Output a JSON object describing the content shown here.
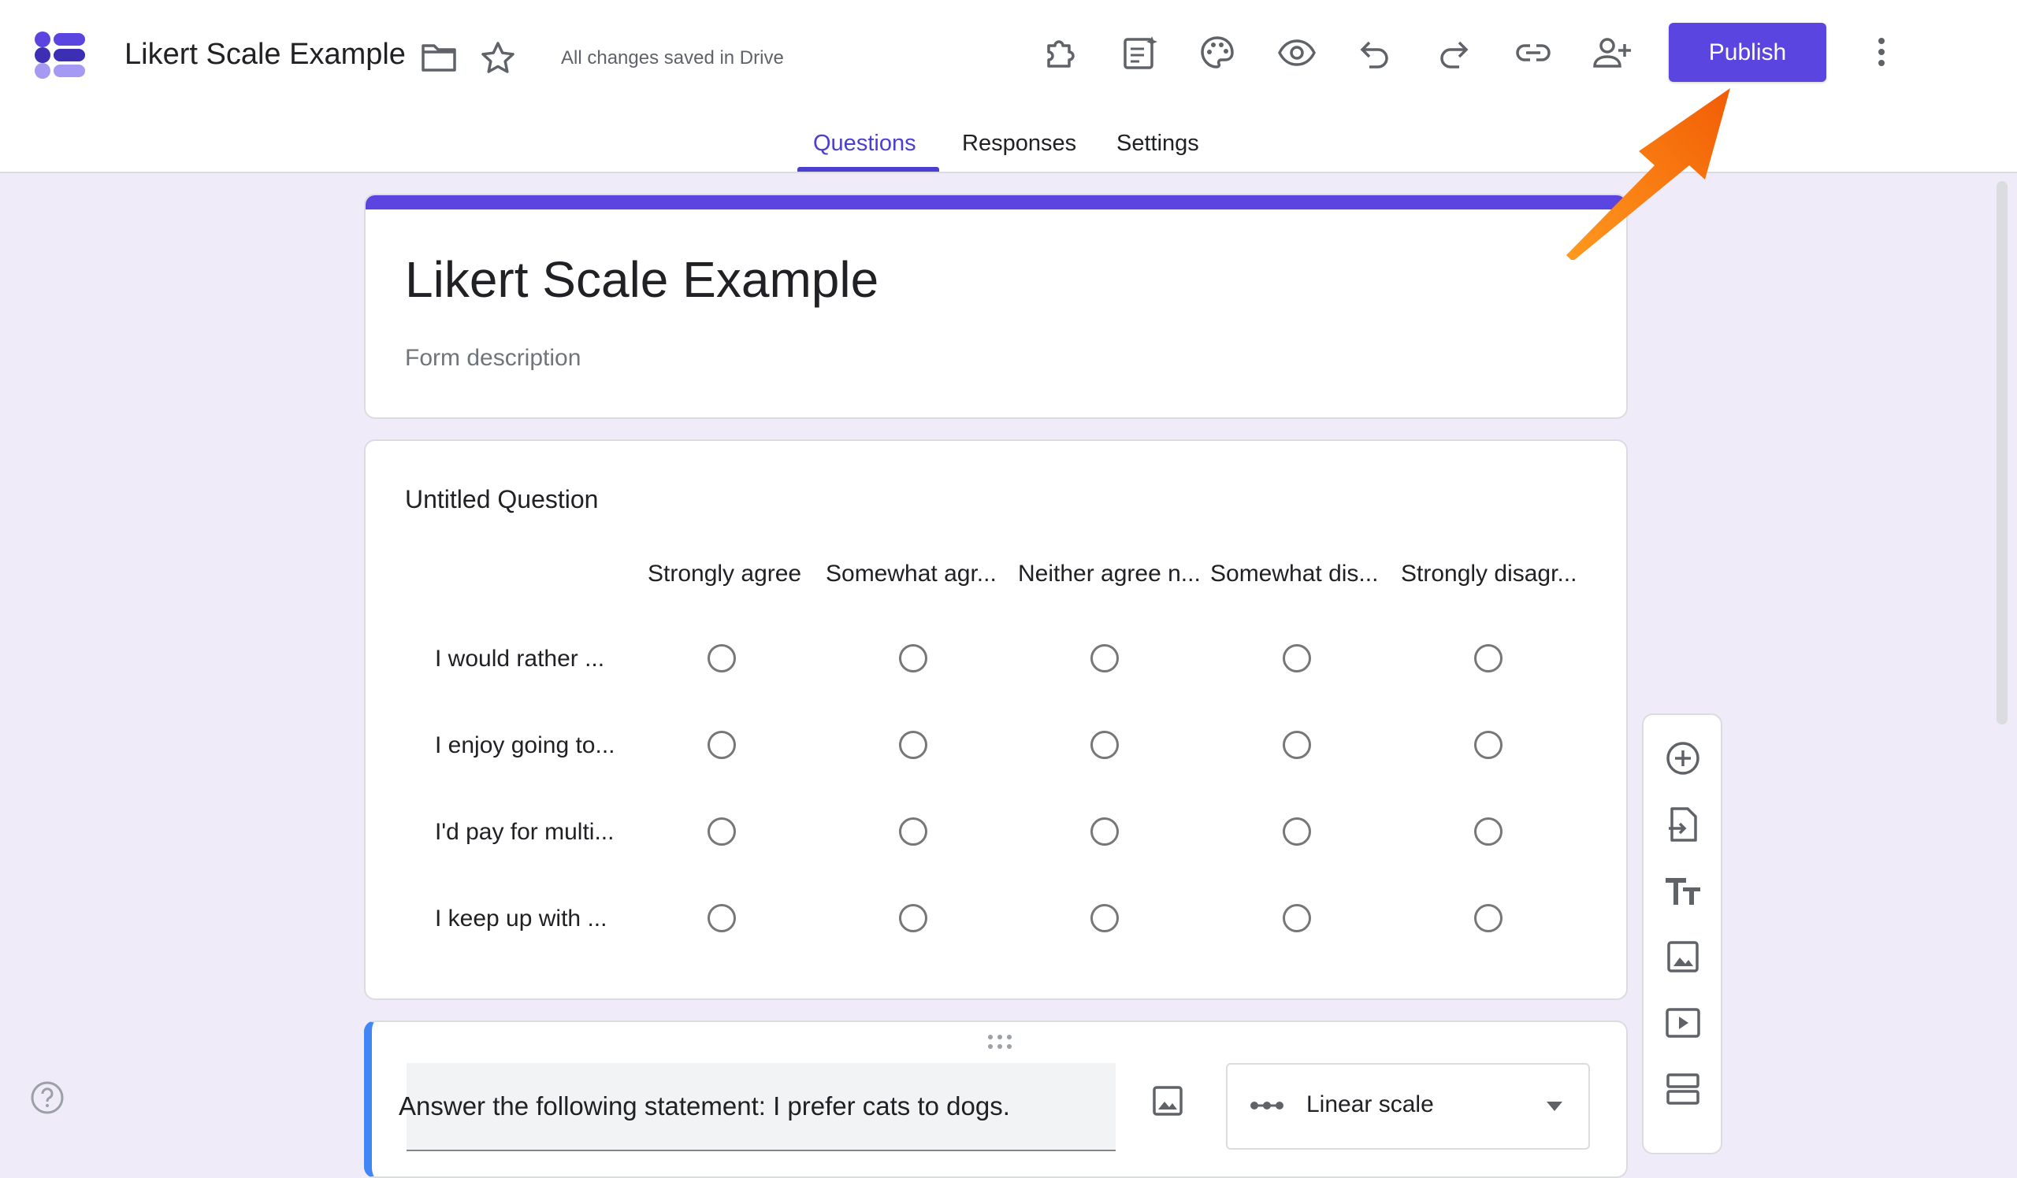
{
  "header": {
    "doc_title": "Likert Scale Example",
    "save_status": "All changes saved in Drive",
    "publish_label": "Publish",
    "icons": [
      "folder-icon",
      "star-icon",
      "addons-icon",
      "gemini-form-icon",
      "palette-icon",
      "preview-eye-icon",
      "undo-icon",
      "redo-icon",
      "link-icon",
      "add-collaborator-icon",
      "more-vert-icon"
    ]
  },
  "tabs": [
    {
      "label": "Questions",
      "active": true
    },
    {
      "label": "Responses",
      "active": false
    },
    {
      "label": "Settings",
      "active": false
    }
  ],
  "form": {
    "title": "Likert Scale Example",
    "description_placeholder": "Form description"
  },
  "question": {
    "title": "Untitled Question",
    "columns": [
      "Strongly agree",
      "Somewhat agr...",
      "Neither agree n...",
      "Somewhat dis...",
      "Strongly disagr..."
    ],
    "rows": [
      "I would rather ...",
      "I enjoy going to...",
      "I'd pay for multi...",
      "I keep up with ..."
    ]
  },
  "editing_question": {
    "text": "Answer the following statement: I prefer cats to dogs.",
    "type": "Linear scale"
  },
  "side_toolbar": [
    "add-question-icon",
    "import-questions-icon",
    "add-title-icon",
    "add-image-icon",
    "add-video-icon",
    "add-section-icon"
  ],
  "colors": {
    "accent": "#5b45e0",
    "background": "#f0ebf8",
    "active_question_border": "#4285f4",
    "annotation_arrow": "#f57c00"
  }
}
